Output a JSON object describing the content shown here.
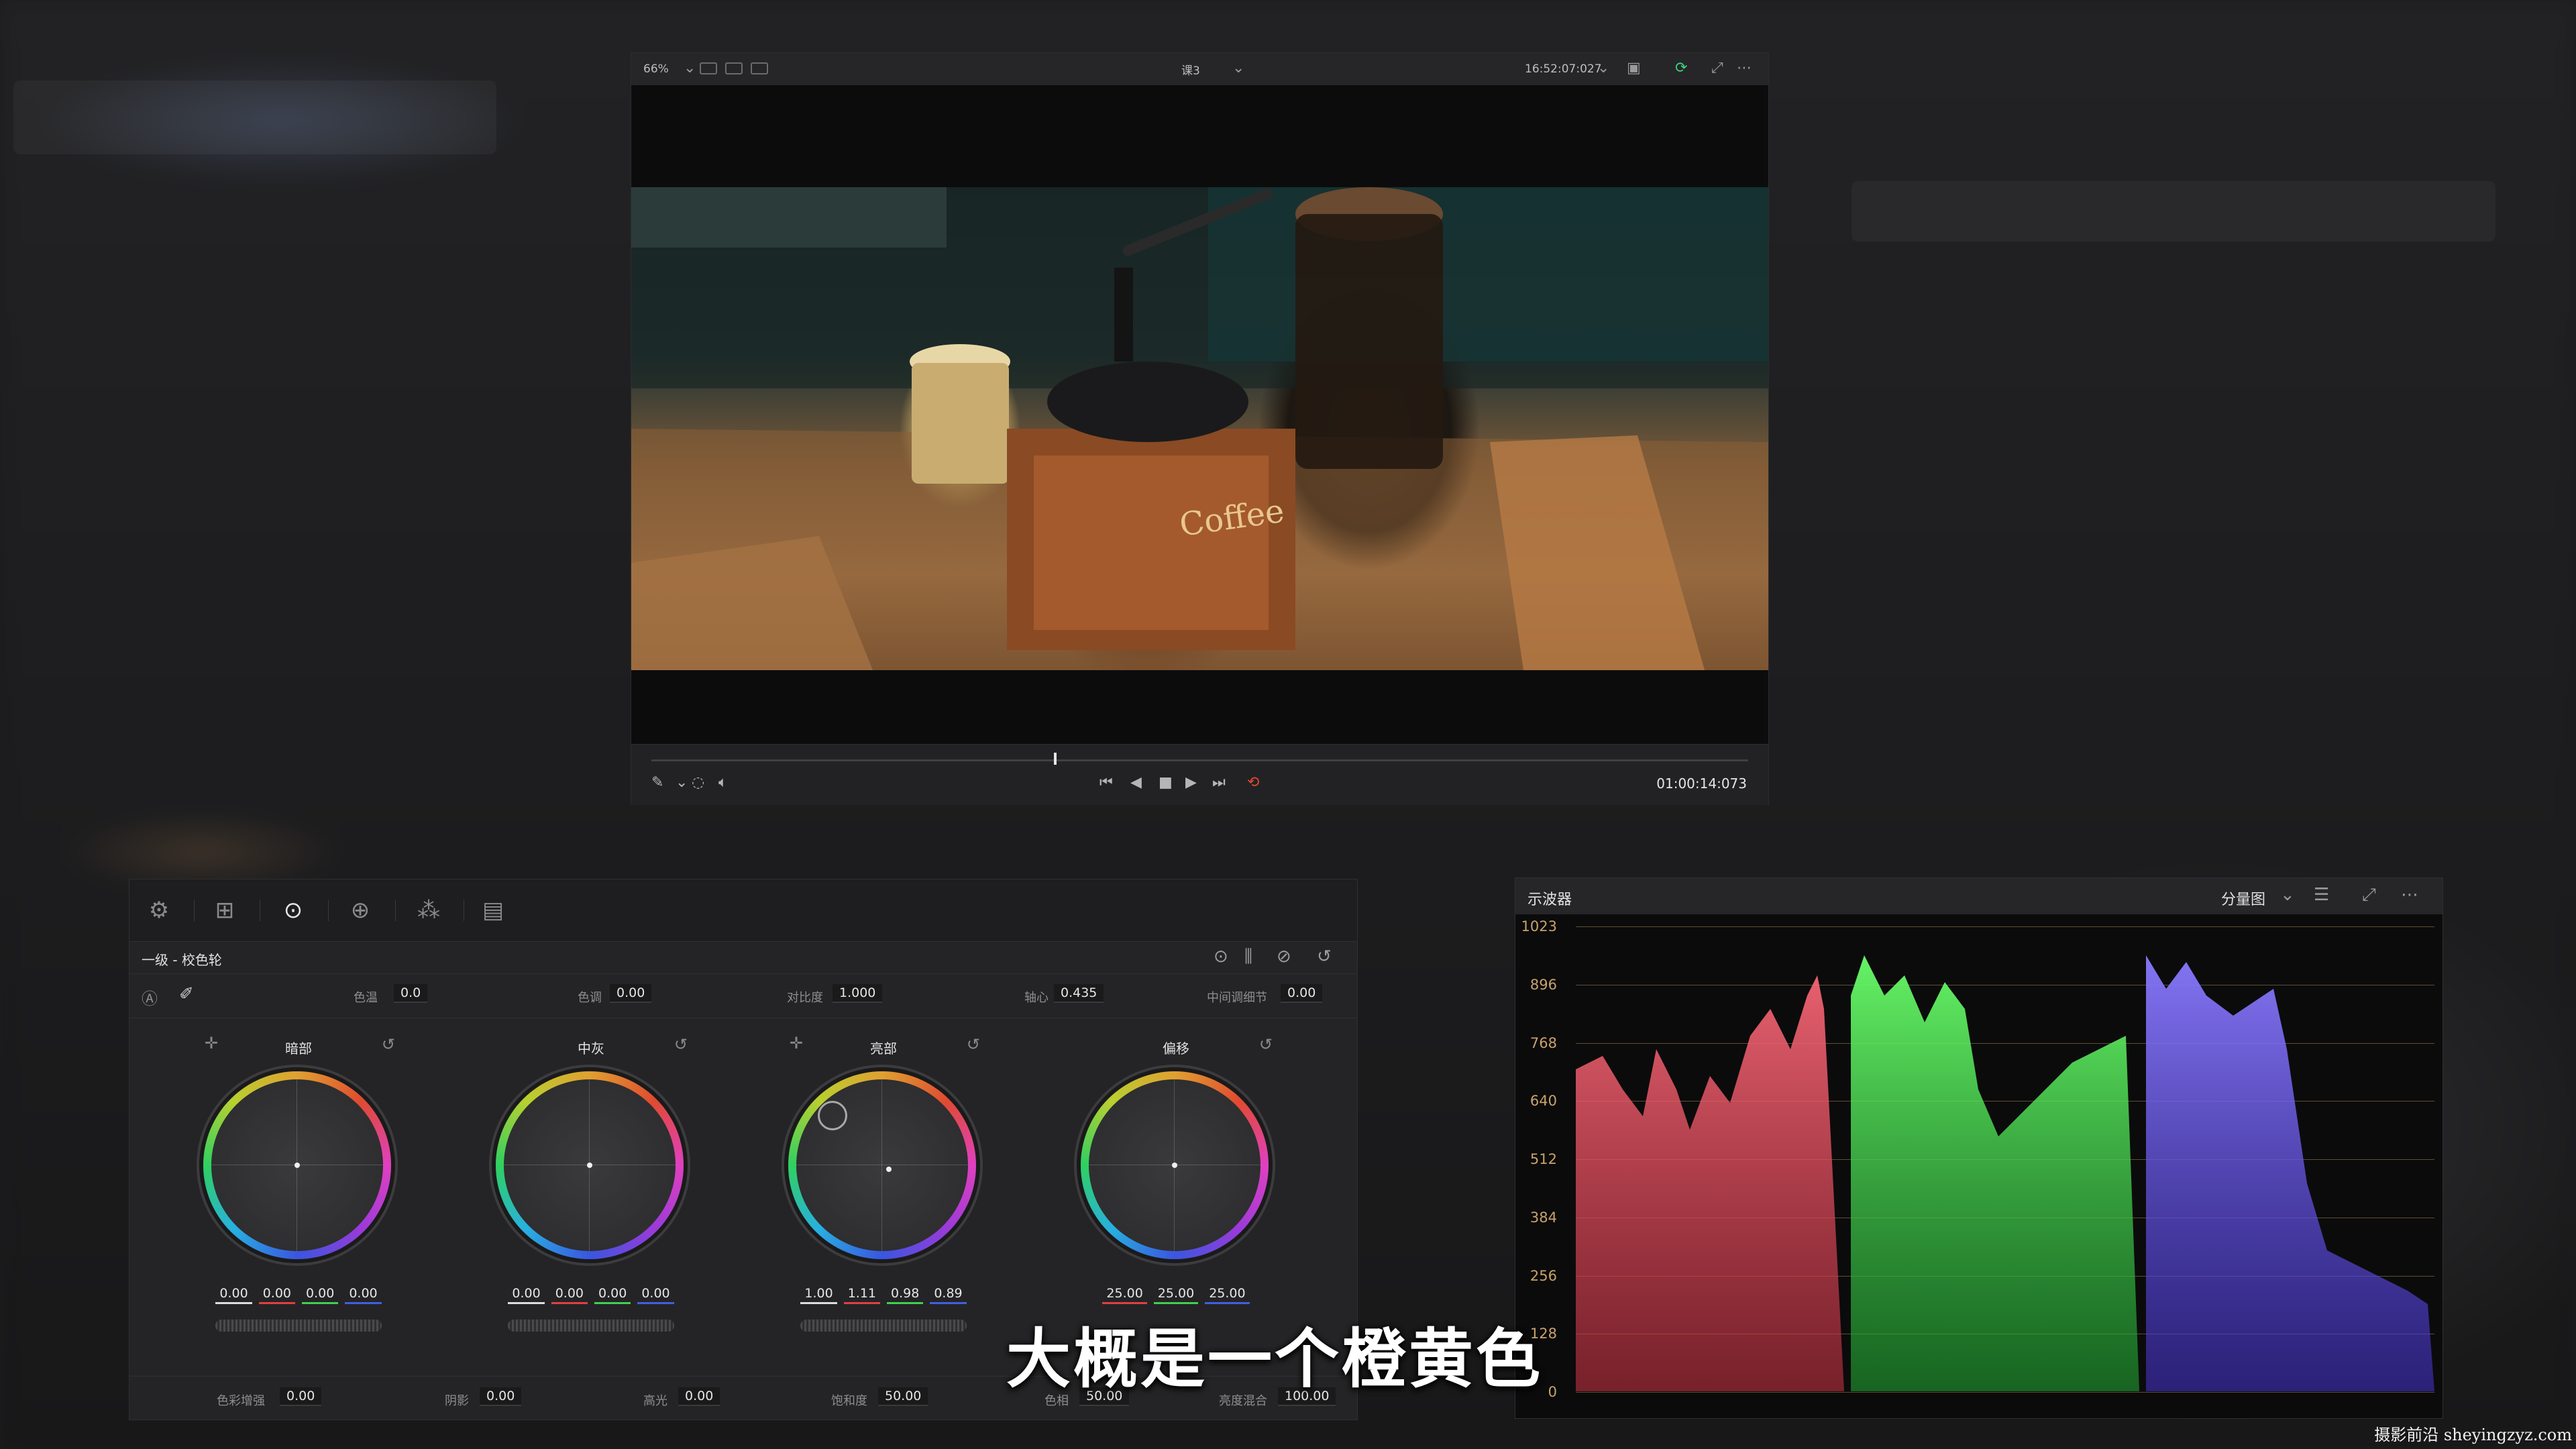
{
  "viewer": {
    "zoom": "66%",
    "clip_name": "课3",
    "timecode_top": "16:52:07:027",
    "timecode_bottom": "01:00:14:073",
    "image_text": "Coffee"
  },
  "color_panel": {
    "title": "一级 - 校色轮",
    "params_top": [
      {
        "label": "色温",
        "value": "0.0"
      },
      {
        "label": "色调",
        "value": "0.00"
      },
      {
        "label": "对比度",
        "value": "1.000"
      },
      {
        "label": "轴心",
        "value": "0.435"
      },
      {
        "label": "中间调细节",
        "value": "0.00"
      }
    ],
    "wheels": [
      {
        "name": "暗部",
        "values": [
          "0.00",
          "0.00",
          "0.00",
          "0.00"
        ]
      },
      {
        "name": "中灰",
        "values": [
          "0.00",
          "0.00",
          "0.00",
          "0.00"
        ]
      },
      {
        "name": "亮部",
        "values": [
          "1.00",
          "1.11",
          "0.98",
          "0.89"
        ]
      },
      {
        "name": "偏移",
        "values": [
          "25.00",
          "25.00",
          "25.00"
        ]
      }
    ],
    "params_bottom": [
      {
        "label": "色彩增强",
        "value": "0.00"
      },
      {
        "label": "阴影",
        "value": "0.00"
      },
      {
        "label": "高光",
        "value": "0.00"
      },
      {
        "label": "饱和度",
        "value": "50.00"
      },
      {
        "label": "色相",
        "value": "50.00"
      },
      {
        "label": "亮度混合",
        "value": "100.00"
      }
    ]
  },
  "scope": {
    "title": "示波器",
    "mode": "分量图",
    "scale": [
      "1023",
      "896",
      "768",
      "640",
      "512",
      "384",
      "256",
      "128",
      "0"
    ]
  },
  "subtitle": "大概是一个橙黄色",
  "watermark": "摄影前沿 sheyingzyz.com",
  "colors": {
    "red_trace": "#e84a5a",
    "green_trace": "#3ee04a",
    "blue_trace": "#6a5af0",
    "accent": "#e04a30"
  }
}
